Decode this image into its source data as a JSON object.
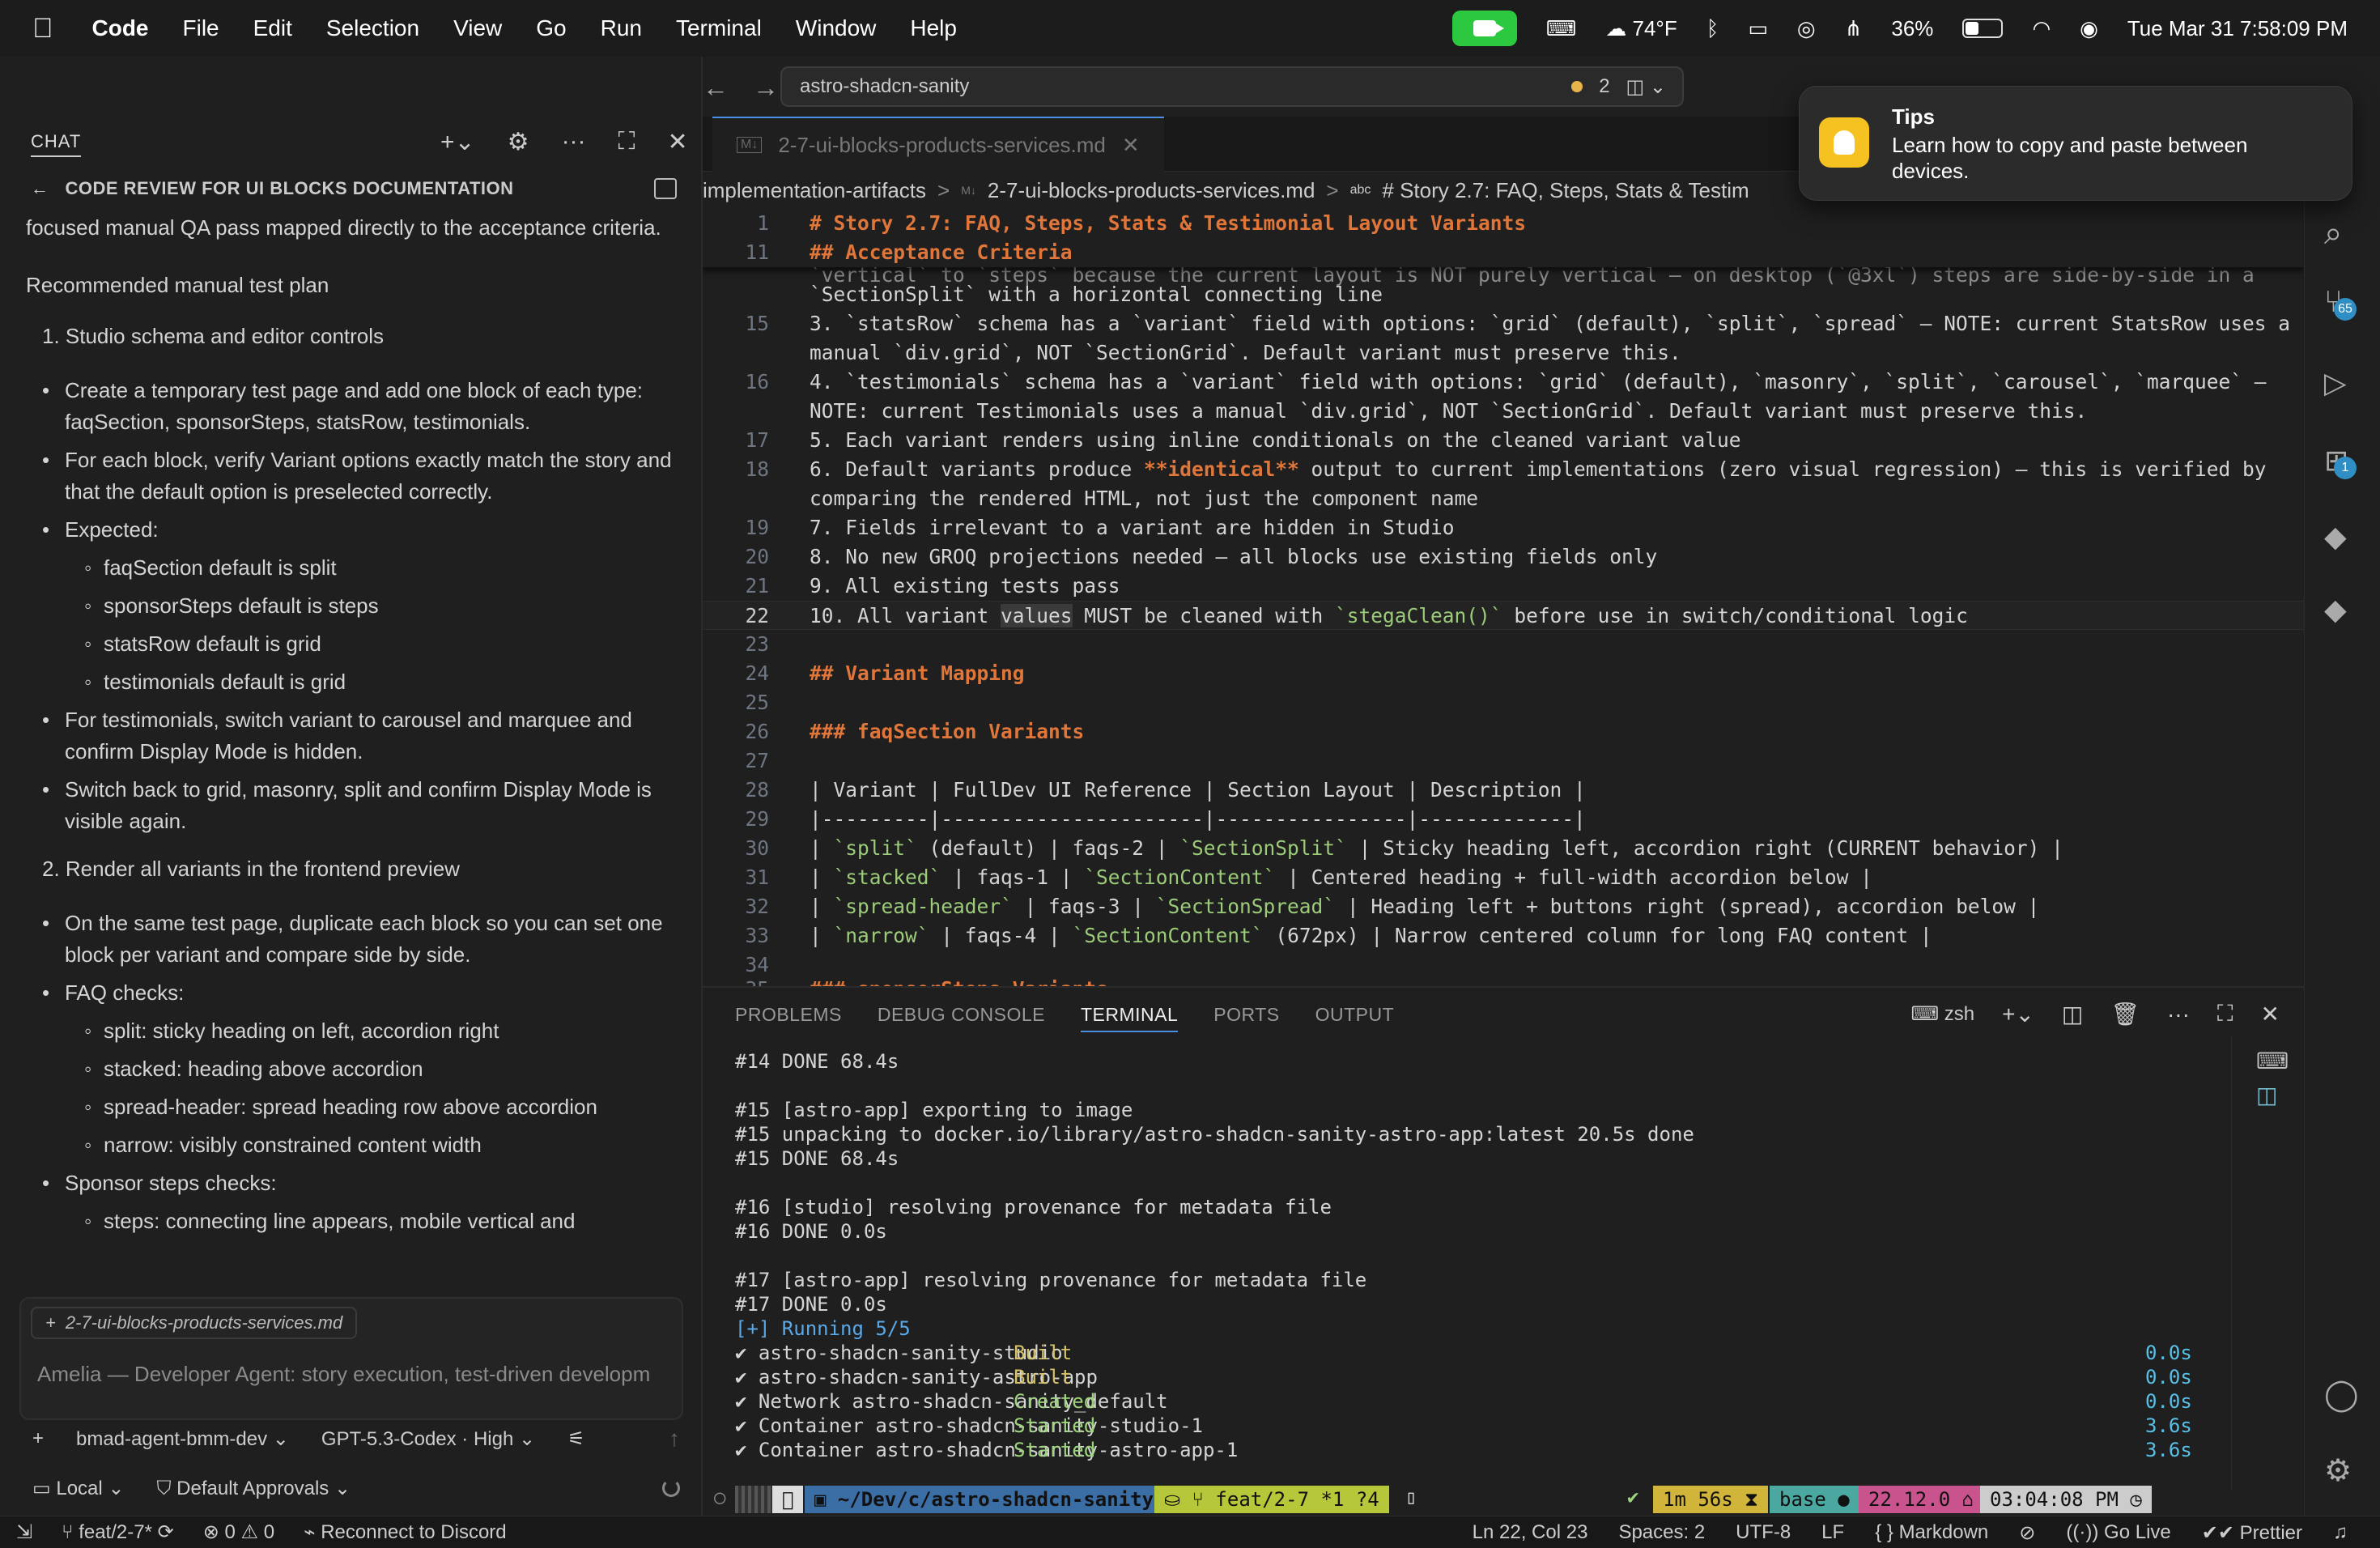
{
  "menubar": {
    "app": "Code",
    "items": [
      "File",
      "Edit",
      "Selection",
      "View",
      "Go",
      "Run",
      "Terminal",
      "Window",
      "Help"
    ],
    "weather": "74°F",
    "battery": "36%",
    "datetime": "Tue Mar 31  7:58:09 PM",
    "battery_level": 0.36
  },
  "chat": {
    "title": "CHAT",
    "session_title": "CODE REVIEW FOR UI BLOCKS DOCUMENTATION",
    "body": {
      "intro": "focused manual QA pass mapped directly to the acceptance criteria.",
      "plan_heading": "Recommended manual test plan",
      "section1": "1. Studio schema and editor controls",
      "s1_b1": "Create a temporary test page and add one block of each type: faqSection, sponsorSteps, statsRow, testimonials.",
      "s1_b2": "For each block, verify Variant options exactly match the story and that the default option is preselected correctly.",
      "s1_b3": "Expected:",
      "s1_e1": "faqSection default is split",
      "s1_e2": "sponsorSteps default is steps",
      "s1_e3": "statsRow default is grid",
      "s1_e4": "testimonials default is grid",
      "s1_b4": "For testimonials, switch variant to carousel and marquee and confirm Display Mode is hidden.",
      "s1_b5": "Switch back to grid, masonry, split and confirm Display Mode is visible again.",
      "section2": "2. Render all variants in the frontend preview",
      "s2_b1": "On the same test page, duplicate each block so you can set one block per variant and compare side by side.",
      "s2_b2": "FAQ checks:",
      "s2_f1": "split: sticky heading on left, accordion right",
      "s2_f2": "stacked: heading above accordion",
      "s2_f3": "spread-header: spread heading row above accordion",
      "s2_f4": "narrow: visibly constrained content width",
      "s2_b3": "Sponsor steps checks:",
      "s2_s1": "steps: connecting line appears, mobile vertical and"
    },
    "attachment": "2-7-ui-blocks-products-services.md",
    "placeholder": "Amelia — Developer Agent: story execution, test-driven developm",
    "agent": "bmad-agent-bmm-dev",
    "model": "GPT-5.3-Codex · High",
    "location": "Local",
    "approvals": "Default Approvals"
  },
  "search": {
    "text": "astro-shadcn-sanity",
    "count": "2"
  },
  "editor": {
    "tab": "2-7-ui-blocks-products-services.md",
    "breadcrumb": [
      "implementation-artifacts",
      "2-7-ui-blocks-products-services.md",
      "# Story 2.7: FAQ, Steps, Stats & Testim"
    ],
    "sticky1_ln": "1",
    "sticky1": "# Story 2.7: FAQ, Steps, Stats & Testimonial Layout Variants",
    "sticky2_ln": "11",
    "sticky2": "## Acceptance Criteria",
    "line14b": "`SectionSplit` with a horizontal connecting line",
    "line14a": "`vertical` to `steps` because the current layout is NOT purely vertical — on desktop (`@3xl`) steps are side-by-side in a",
    "l15a": "3. `statsRow` schema has a `variant` field with options: `grid` (default), `split`, `spread` — NOTE: current StatsRow uses a",
    "l15b": "manual `div.grid`, NOT `SectionGrid`. Default variant must preserve this.",
    "l16a": "4. `testimonials` schema has a `variant` field with options: `grid` (default), `masonry`, `split`, `carousel`, `marquee` —",
    "l16b": "NOTE: current Testimonials uses a manual `div.grid`, NOT `SectionGrid`. Default variant must preserve this.",
    "l17": "5. Each variant renders using inline conditionals on the cleaned variant value",
    "l18a_pre": "6. Default variants produce ",
    "l18a_bold": "**identical**",
    "l18a_post": " output to current implementations (zero visual regression) — this is verified by",
    "l18b": "comparing the rendered HTML, not just the component name",
    "l19": "7. Fields irrelevant to a variant are hidden in Studio",
    "l20": "8. No new GROQ projections needed — all blocks use existing fields only",
    "l21": "9. All existing tests pass",
    "l22_pre": "10. All variant ",
    "l22_hl": "values",
    "l22_mid": " MUST be cleaned with ",
    "l22_code": "`stegaClean()`",
    "l22_post": " before use in switch/conditional logic",
    "l24": "## Variant Mapping",
    "l26": "### faqSection Variants",
    "l28": "| Variant | FullDev UI Reference | Section Layout | Description |",
    "l29": "|---------|----------------------|----------------|-------------|",
    "l30_a": "`split`",
    "l30_b": " (default) | faqs-2 | ",
    "l30_c": "`SectionSplit`",
    "l30_d": " | Sticky heading left, accordion right (CURRENT behavior) |",
    "l31_a": "`stacked`",
    "l31_b": " | faqs-1 | ",
    "l31_c": "`SectionContent`",
    "l31_d": " | Centered heading + full-width accordion below |",
    "l32_a": "`spread-header`",
    "l32_b": " | faqs-3 | ",
    "l32_c": "`SectionSpread`",
    "l32_d": " | Heading left + buttons right (spread), accordion below |",
    "l33_a": "`narrow`",
    "l33_b": " | faqs-4 | ",
    "l33_c": "`SectionContent`",
    "l33_d": " (672px) | Narrow centered column for long FAQ content |",
    "l35": "### sponsorSteps Variants"
  },
  "panel": {
    "tabs": [
      "PROBLEMS",
      "DEBUG CONSOLE",
      "TERMINAL",
      "PORTS",
      "OUTPUT"
    ],
    "shell": "zsh",
    "terminal": {
      "t1": "#14 DONE 68.4s",
      "t2": "#15 [astro-app] exporting to image",
      "t3": "#15 unpacking to docker.io/library/astro-shadcn-sanity-astro-app:latest 20.5s done",
      "t4": "#15 DONE 68.4s",
      "t5": "#16 [studio] resolving provenance for metadata file",
      "t6": "#16 DONE 0.0s",
      "t7": "#17 [astro-app] resolving provenance for metadata file",
      "t8": "#17 DONE 0.0s",
      "t9": "[+] Running 5/5",
      "rows": [
        {
          "name": "✔ astro-shadcn-sanity-studio",
          "status": "Built",
          "time": "0.0s"
        },
        {
          "name": "✔ astro-shadcn-sanity-astro-app",
          "status": "Built",
          "time": "0.0s"
        },
        {
          "name": "✔ Network astro-shadcn-sanity_default",
          "status": "Created",
          "time": "0.0s"
        },
        {
          "name": "✔ Container astro-shadcn-sanity-studio-1",
          "status": "Started",
          "time": "3.6s"
        },
        {
          "name": "✔ Container astro-shadcn-sanity-astro-app-1",
          "status": "Started",
          "time": "3.6s"
        }
      ]
    },
    "prompt": {
      "path": "~/Dev/c/astro-shadcn-sanity",
      "branch": "feat/2-7 *1 ?4",
      "duration": "1m 56s",
      "env": "base",
      "node": "22.12.0",
      "time": "03:04:08 PM"
    }
  },
  "statusbar": {
    "branch": "feat/2-7*",
    "errors": "0",
    "warnings": "0",
    "discord": "Reconnect to Discord",
    "position": "Ln 22, Col 23",
    "spaces": "Spaces: 2",
    "encoding": "UTF-8",
    "eol": "LF",
    "language": "Markdown",
    "golive": "Go Live",
    "prettier": "Prettier"
  },
  "activity": {
    "scm_badge": "65",
    "ext_badge": "1"
  },
  "tips": {
    "title": "Tips",
    "body": "Learn how to copy and paste between devices."
  }
}
